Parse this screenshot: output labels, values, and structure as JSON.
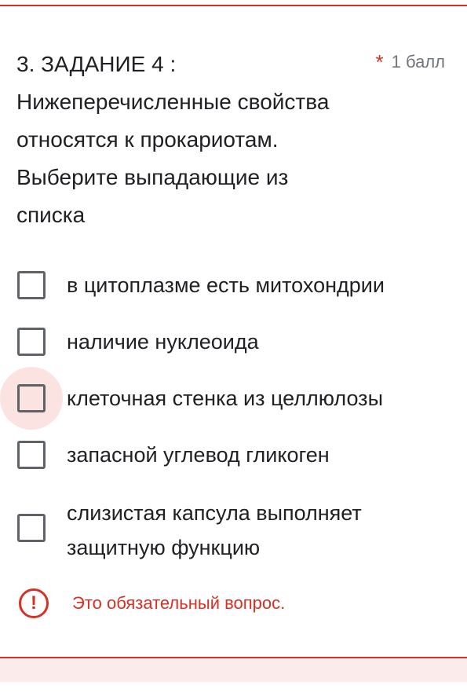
{
  "question": {
    "title": "3. ЗАДАНИЕ 4 : Нижеперечисленные свойства относятся к прокариотам. Выберите выпадающие из списка",
    "required_mark": "*",
    "points": "1 балл"
  },
  "options": [
    {
      "label": "в цитоплазме есть митохондрии",
      "checked": false
    },
    {
      "label": "наличие нуклеоида",
      "checked": false
    },
    {
      "label": "клеточная стенка из целлюлозы",
      "checked": false,
      "focused": true
    },
    {
      "label": "запасной углевод гликоген",
      "checked": false
    },
    {
      "label": "слизистая капсула выполняет защитную функцию",
      "checked": false
    }
  ],
  "validation": {
    "icon": "error-icon",
    "message": "Это обязательный вопрос."
  },
  "colors": {
    "error": "#d93025",
    "text": "#202124",
    "muted": "#70757a",
    "checkbox_border": "#5f6368",
    "focus_ripple": "#fbe3e1"
  }
}
